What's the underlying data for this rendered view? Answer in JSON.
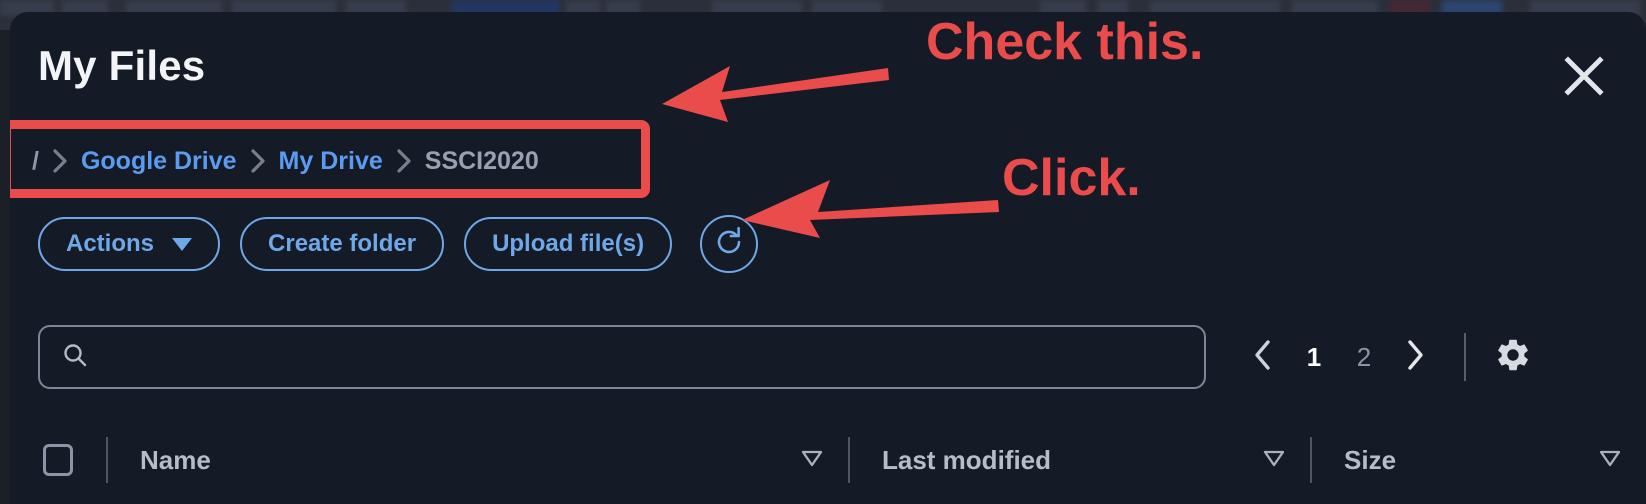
{
  "window": {
    "title": "My Files",
    "close_label": "×",
    "close_icon": "close-icon"
  },
  "breadcrumb": {
    "items": [
      {
        "label": "/",
        "type": "root"
      },
      {
        "label": "Google Drive",
        "type": "link"
      },
      {
        "label": "My Drive",
        "type": "link"
      },
      {
        "label": "SSCI2020",
        "type": "current"
      }
    ],
    "separator_icon": "chevron-right-icon",
    "highlight_color": "#ea4b4b"
  },
  "toolbar": {
    "actions_label": "Actions",
    "actions_caret_icon": "chevron-down-icon",
    "create_folder_label": "Create folder",
    "upload_files_label": "Upload file(s)",
    "refresh_icon": "refresh-icon",
    "accent_color": "#6fa8e8"
  },
  "search": {
    "icon": "search-icon",
    "value": "",
    "placeholder": ""
  },
  "pagination": {
    "prev_icon": "chevron-left-icon",
    "next_icon": "chevron-right-icon",
    "pages": [
      {
        "label": "1",
        "active": true
      },
      {
        "label": "2",
        "active": false
      }
    ],
    "settings_icon": "gear-icon"
  },
  "table": {
    "select_all_checked": false,
    "columns": [
      {
        "label": "Name",
        "sort_icon": "sort-descending-icon"
      },
      {
        "label": "Last modified",
        "sort_icon": "sort-descending-icon"
      },
      {
        "label": "Size",
        "sort_icon": "sort-descending-icon"
      }
    ]
  },
  "annotations": [
    {
      "text": "Check this.",
      "color": "#ea4b4b",
      "target": "breadcrumb"
    },
    {
      "text": "Click.",
      "color": "#ea4b4b",
      "target": "upload-files-button"
    }
  ],
  "annotation_text": {
    "check_this": "Check this.",
    "click": "Click."
  }
}
